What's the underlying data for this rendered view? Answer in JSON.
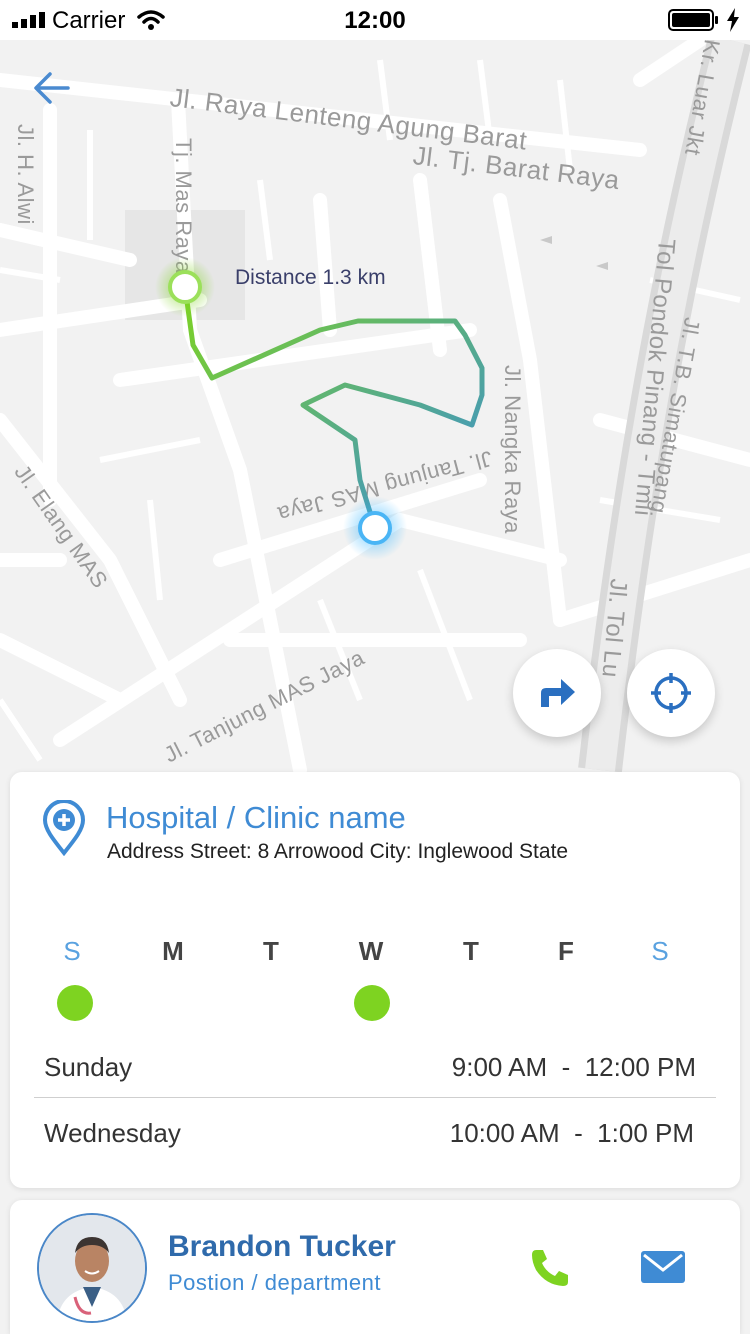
{
  "status_bar": {
    "carrier": "Carrier",
    "time": "12:00"
  },
  "map": {
    "streets": [
      {
        "text": "Jl. Raya Lenteng Agung Barat"
      },
      {
        "text": "Jl. Tj. Barat Raya"
      },
      {
        "text": "Jl. H. Alwi"
      },
      {
        "text": "Tj. Mas Raya"
      },
      {
        "text": "Jl. Nangka Raya"
      },
      {
        "text": "Jl. Elang MAS"
      },
      {
        "text": "Jl. Tanjung MAS Jaya"
      },
      {
        "text": "Jl. Tanjung MAS Jaya"
      },
      {
        "text": "Tol Pondok Pinang - Tmii"
      },
      {
        "text": "Jl. T.B. Simatupang"
      },
      {
        "text": "Jl. Tol Lu"
      },
      {
        "text": "Kr. Luar Jkt"
      }
    ],
    "distance_label": "Distance 1.3 km",
    "route_colors": {
      "start": "#7ed321",
      "end": "#3a8fd6"
    }
  },
  "hospital": {
    "name": "Hospital / Clinic name",
    "address": "Address Street: 8 Arrowood City: Inglewood State"
  },
  "days": [
    {
      "letter": "S",
      "weekend": true,
      "active": true
    },
    {
      "letter": "M",
      "weekend": false,
      "active": false
    },
    {
      "letter": "T",
      "weekend": false,
      "active": false
    },
    {
      "letter": "W",
      "weekend": false,
      "active": true
    },
    {
      "letter": "T",
      "weekend": false,
      "active": false
    },
    {
      "letter": "F",
      "weekend": false,
      "active": false
    },
    {
      "letter": "S",
      "weekend": true,
      "active": false
    }
  ],
  "schedule": [
    {
      "day": "Sunday",
      "hours": "9:00 AM  -  12:00 PM"
    },
    {
      "day": "Wednesday",
      "hours": "10:00 AM  -  1:00 PM"
    }
  ],
  "doctor": {
    "name": "Brandon Tucker",
    "department": "Postion / department"
  },
  "colors": {
    "accent": "#3f8bd4",
    "active_day": "#7ed321",
    "call": "#7ed321",
    "mail": "#3f8bd4"
  },
  "icons": {
    "back": "arrow-left-icon",
    "directions": "turn-right-arrow-icon",
    "locate": "crosshair-icon",
    "pin": "medical-pin-icon",
    "call": "phone-icon",
    "mail": "envelope-icon"
  }
}
